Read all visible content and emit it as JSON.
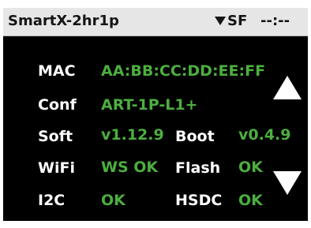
{
  "header": {
    "title": "SmartX-2hr1p",
    "wifi_icon": "wifi-signal-icon",
    "site": "SF",
    "time": "--:--"
  },
  "rows": {
    "mac_label": "MAC",
    "mac_value": "AA:BB:CC:DD:EE:FF",
    "conf_label": "Conf",
    "conf_value": "ART-1P-L1+",
    "soft_label": "Soft",
    "soft_value": "v1.12.9",
    "boot_label": "Boot",
    "boot_value": "v0.4.9",
    "wifi_label": "WiFi",
    "wifi_value": "WS OK",
    "flash_label": "Flash",
    "flash_value": "OK",
    "i2c_label": "I2C",
    "i2c_value": "OK",
    "hsdc_label": "HSDC",
    "hsdc_value": "OK"
  },
  "nav": {
    "up_icon": "triangle-up-icon",
    "down_icon": "triangle-down-icon"
  },
  "colors": {
    "background": "#000000",
    "header_bg": "#e6e6e6",
    "label": "#ffffff",
    "value": "#4caf3f"
  }
}
